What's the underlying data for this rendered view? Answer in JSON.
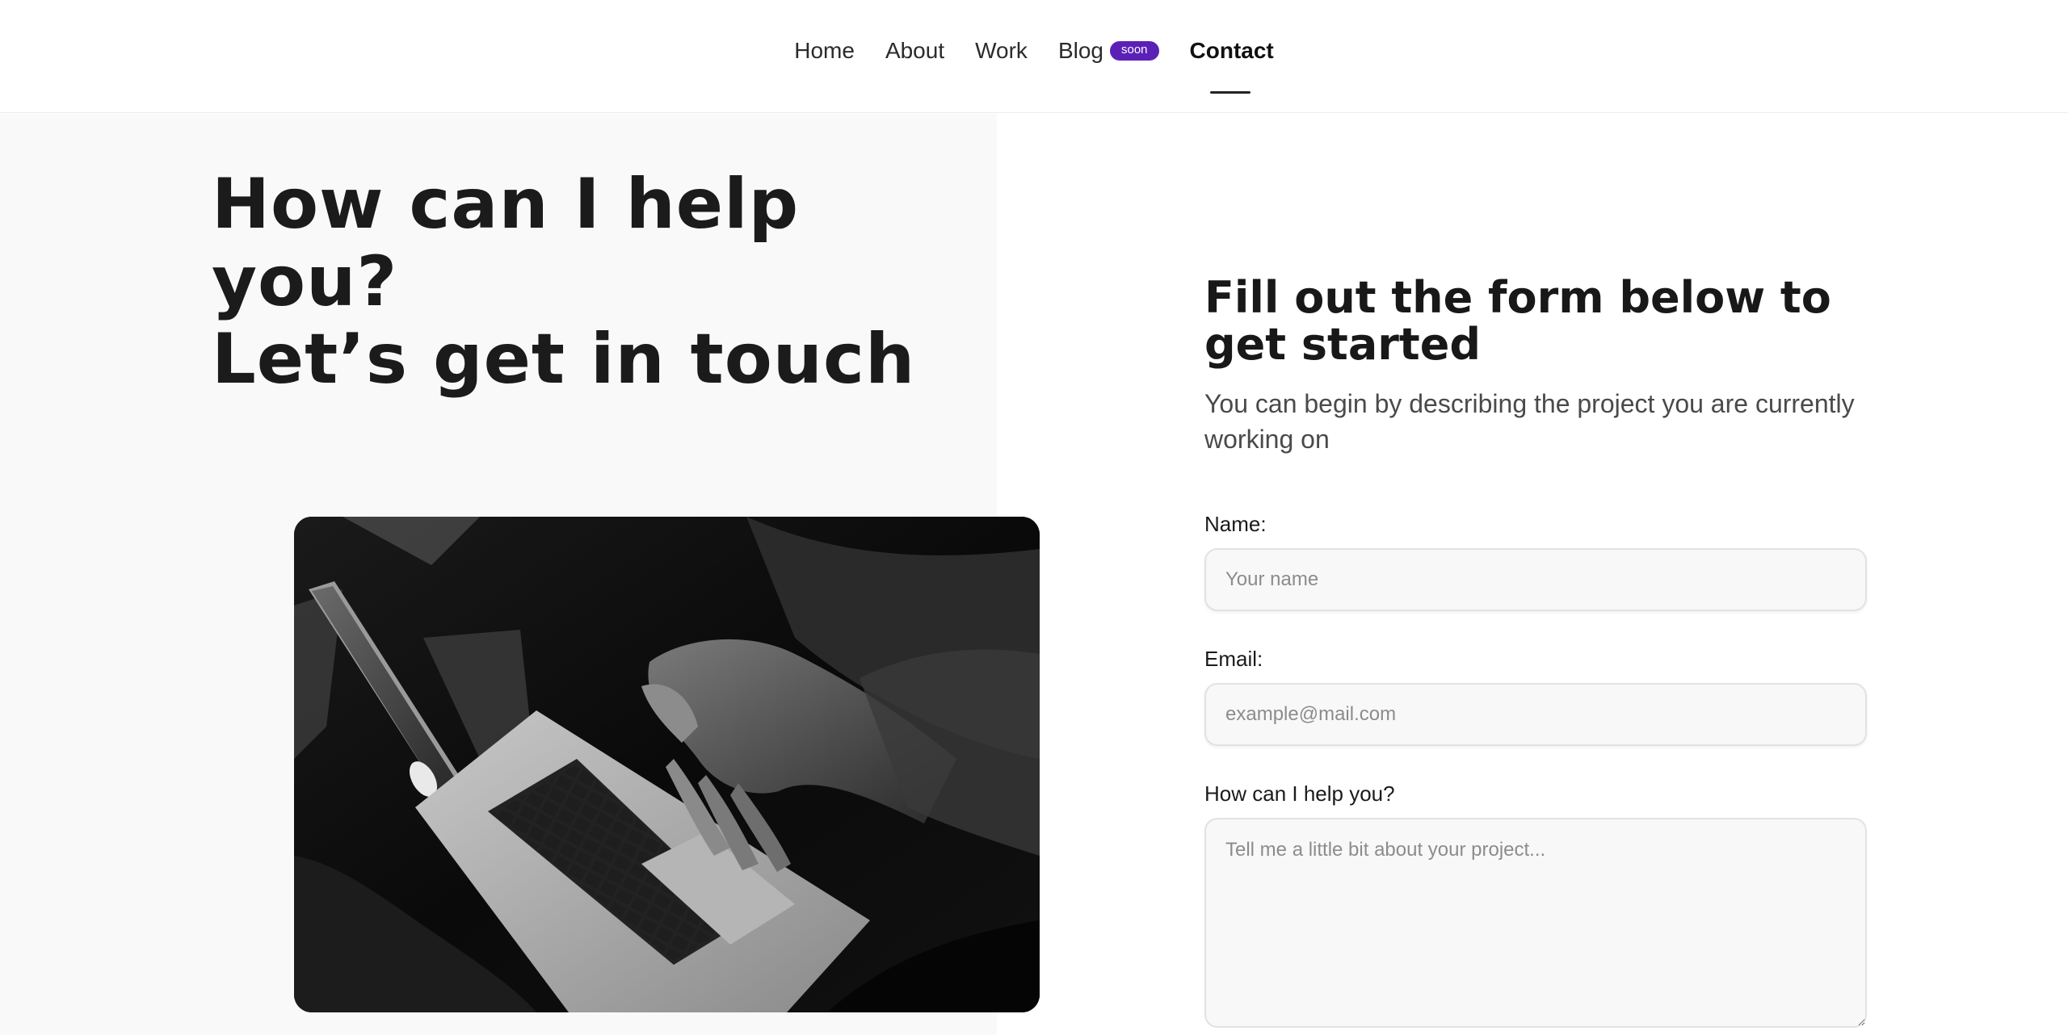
{
  "nav": {
    "items": [
      {
        "label": "Home"
      },
      {
        "label": "About"
      },
      {
        "label": "Work"
      },
      {
        "label": "Blog",
        "badge": "soon"
      },
      {
        "label": "Contact",
        "active": true
      }
    ]
  },
  "hero": {
    "line1": "How can I help you?",
    "line2": "Let’s get in touch"
  },
  "form": {
    "title": "Fill out the form below to get started",
    "subtitle": "You can begin by describing the project you are currently working on",
    "name_label": "Name:",
    "name_placeholder": "Your name",
    "email_label": "Email:",
    "email_placeholder": "example@mail.com",
    "message_label": "How can I help you?",
    "message_placeholder": "Tell me a little bit about your project..."
  },
  "colors": {
    "badge": "#5b21b6",
    "left_panel_bg": "#f9f9f9"
  }
}
